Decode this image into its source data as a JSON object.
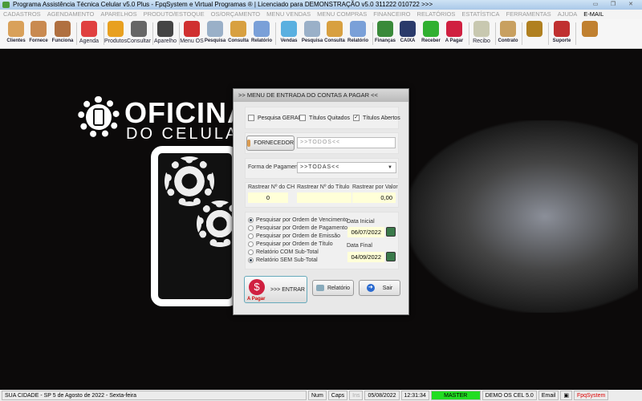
{
  "window": {
    "title": "Programa Assistência Técnica Celular v5.0 Plus - FpqSystem e Virtual Programas ® | Licenciado para  DEMONSTRAÇÃO v5.0 311222 010722 >>>"
  },
  "menu": [
    "CADASTROS",
    "AGENDAMENTO",
    "APARELHOS",
    "PRODUTO/ESTOQUE",
    "OS/ORÇAMENTO",
    "MENU VENDAS",
    "MENU COMPRAS",
    "FINANCEIRO",
    "RELATÓRIOS",
    "ESTATÍSTICA",
    "FERRAMENTAS",
    "AJUDA"
  ],
  "menu_email": "E-MAIL",
  "toolbar": [
    {
      "label": "Clientes",
      "color": "#d9a15a"
    },
    {
      "label": "Fornece",
      "color": "#c98a50"
    },
    {
      "label": "Funciona",
      "color": "#b07040"
    },
    {
      "label": "Agenda",
      "color": "#e04040"
    },
    {
      "label": "Produtos",
      "color": "#e8a020"
    },
    {
      "label": "Consultar",
      "color": "#666666"
    },
    {
      "label": "Aparelho",
      "color": "#444444"
    },
    {
      "label": "Menu OS",
      "color": "#d03030"
    },
    {
      "label": "Pesquisa",
      "color": "#9ab0c8"
    },
    {
      "label": "Consulta",
      "color": "#d8a040"
    },
    {
      "label": "Relatório",
      "color": "#7aa0d8"
    },
    {
      "label": "Vendas",
      "color": "#5ab0e0"
    },
    {
      "label": "Pesquisa",
      "color": "#9ab0c8"
    },
    {
      "label": "Consulta",
      "color": "#d8a040"
    },
    {
      "label": "Relatório",
      "color": "#7aa0d8"
    },
    {
      "label": "Finanças",
      "color": "#3a8a3a"
    },
    {
      "label": "CAIXA",
      "color": "#2a3a6a"
    },
    {
      "label": "Receber",
      "color": "#30b030"
    },
    {
      "label": "A Pagar",
      "color": "#d02040"
    },
    {
      "label": "Recibo",
      "color": "#c8c8b0"
    },
    {
      "label": "Contrato",
      "color": "#c8a060"
    },
    {
      "label": "",
      "color": "#b08020"
    },
    {
      "label": "Suporte",
      "color": "#c03030"
    },
    {
      "label": "",
      "color": "#c08030"
    }
  ],
  "logo": {
    "line1": "OFICINA",
    "line2": "DO CELULAR"
  },
  "dialog": {
    "title": ">>  MENU DE ENTRADA DO CONTAS A PAGAR  <<",
    "checks": [
      {
        "label": "Pesquisa GERAL",
        "checked": false
      },
      {
        "label": "Títulos Quitados",
        "checked": false
      },
      {
        "label": "Títulos Abertos",
        "checked": true
      }
    ],
    "fornecedor_button": "FORNECEDOR",
    "fornecedor_value": ">>TODOS<<",
    "forma_label": "Forma de Pagamento",
    "forma_value": ">>TODAS<<",
    "rastrear": [
      {
        "label": "Rastrear Nº do CH",
        "value": "0"
      },
      {
        "label": "Rastrear Nº do Título",
        "value": ""
      },
      {
        "label": "Rastrear por Valor",
        "value": "0,00"
      }
    ],
    "radios": [
      {
        "label": "Pesquisar por Ordem de Vencimento",
        "checked": true
      },
      {
        "label": "Pesquisar por Ordem de Pagamento",
        "checked": false
      },
      {
        "label": "Pesquisar por Ordem de Emissão",
        "checked": false
      },
      {
        "label": "Pesquisar por Ordem de Título",
        "checked": false
      },
      {
        "label": "Relatório COM Sub-Total",
        "checked": false
      },
      {
        "label": "Relatório SEM Sub-Total",
        "checked": true
      }
    ],
    "data_inicial_label": "Data Inicial",
    "data_inicial": "06/07/2022",
    "data_final_label": "Data Final",
    "data_final": "04/09/2022",
    "enter_icon_label": "A Pagar",
    "enter_button": ">>> ENTRAR",
    "report_button": "Relatório",
    "exit_button": "Sair"
  },
  "status": {
    "city": "SUA CIDADE - SP  5 de Agosto de 2022 - Sexta-feira",
    "num": "Num",
    "caps": "Caps",
    "ins": "Ins",
    "date": "05/08/2022",
    "time": "12:31:34",
    "user": "MASTER",
    "db": "DEMO OS CEL 5.0",
    "email": "Email",
    "brand": "FpqSystem"
  }
}
